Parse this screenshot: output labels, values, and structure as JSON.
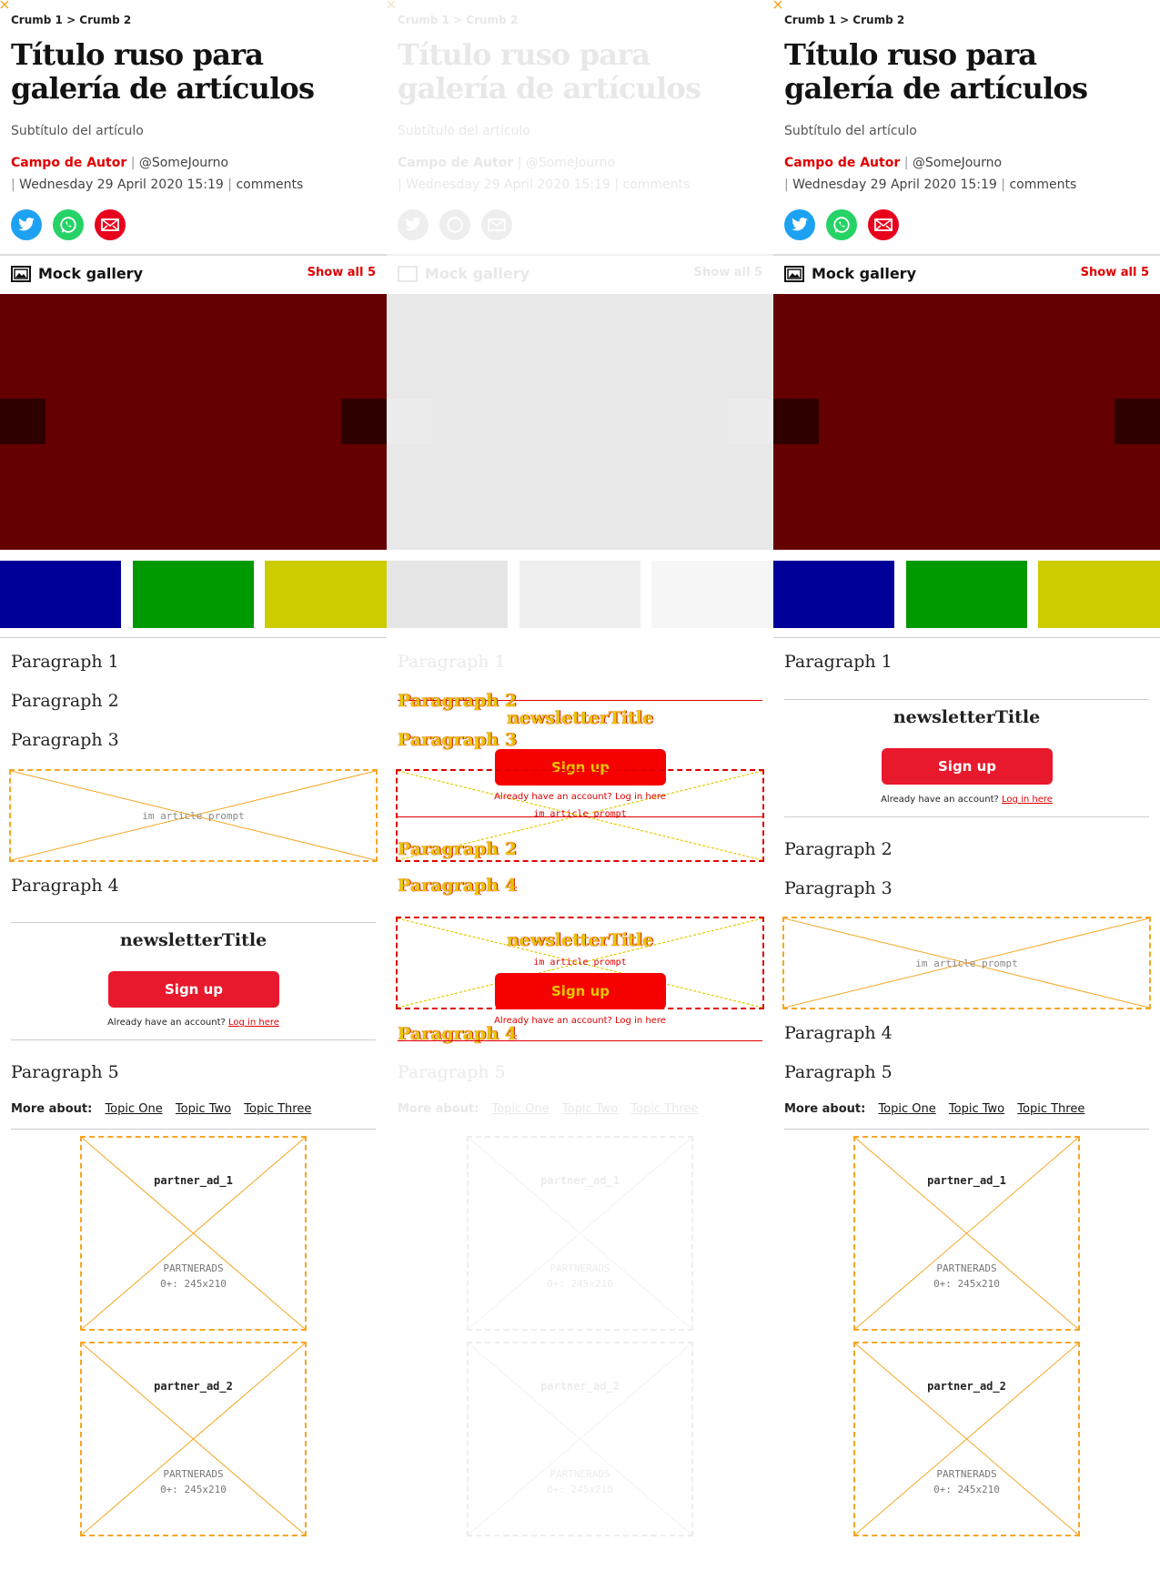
{
  "breadcrumb": "Crumb 1 > Crumb 2",
  "title": "Título ruso para galería de artículos",
  "subtitle": "Subtítulo del artículo",
  "byline": {
    "author": "Campo de Autor",
    "separator": "|",
    "handle": "@SomeJourno",
    "date": "Wednesday 29 April 2020 15:19",
    "comments": "comments"
  },
  "share": {
    "twitter": "twitter-icon",
    "whatsapp": "whatsapp-icon",
    "email": "email-icon"
  },
  "gallery": {
    "title": "Mock gallery",
    "show_all": "Show all 5",
    "hero_color": "#650000",
    "thumb_colors": [
      "#000099",
      "#009900",
      "#cccc00"
    ]
  },
  "paragraphs": [
    "Paragraph 1",
    "Paragraph 2",
    "Paragraph 3",
    "Paragraph 4",
    "Paragraph 5"
  ],
  "prompt_label": "im article prompt",
  "newsletter": {
    "title": "newsletterTitle",
    "button": "Sign up",
    "note": "Already have an account?",
    "login": "Log in here"
  },
  "more_about": {
    "label": "More about:",
    "topics": [
      "Topic One",
      "Topic Two",
      "Topic Three"
    ]
  },
  "ads": [
    {
      "name": "partner_ad_1",
      "provider": "PARTNERADS",
      "size": "0+: 245x210"
    },
    {
      "name": "partner_ad_2",
      "provider": "PARTNERADS",
      "size": "0+: 245x210"
    }
  ],
  "colors": {
    "accent": "#e00000",
    "button": "#e8192c",
    "placeholder": "#f5a623",
    "diff_highlight": "#e6c800"
  }
}
